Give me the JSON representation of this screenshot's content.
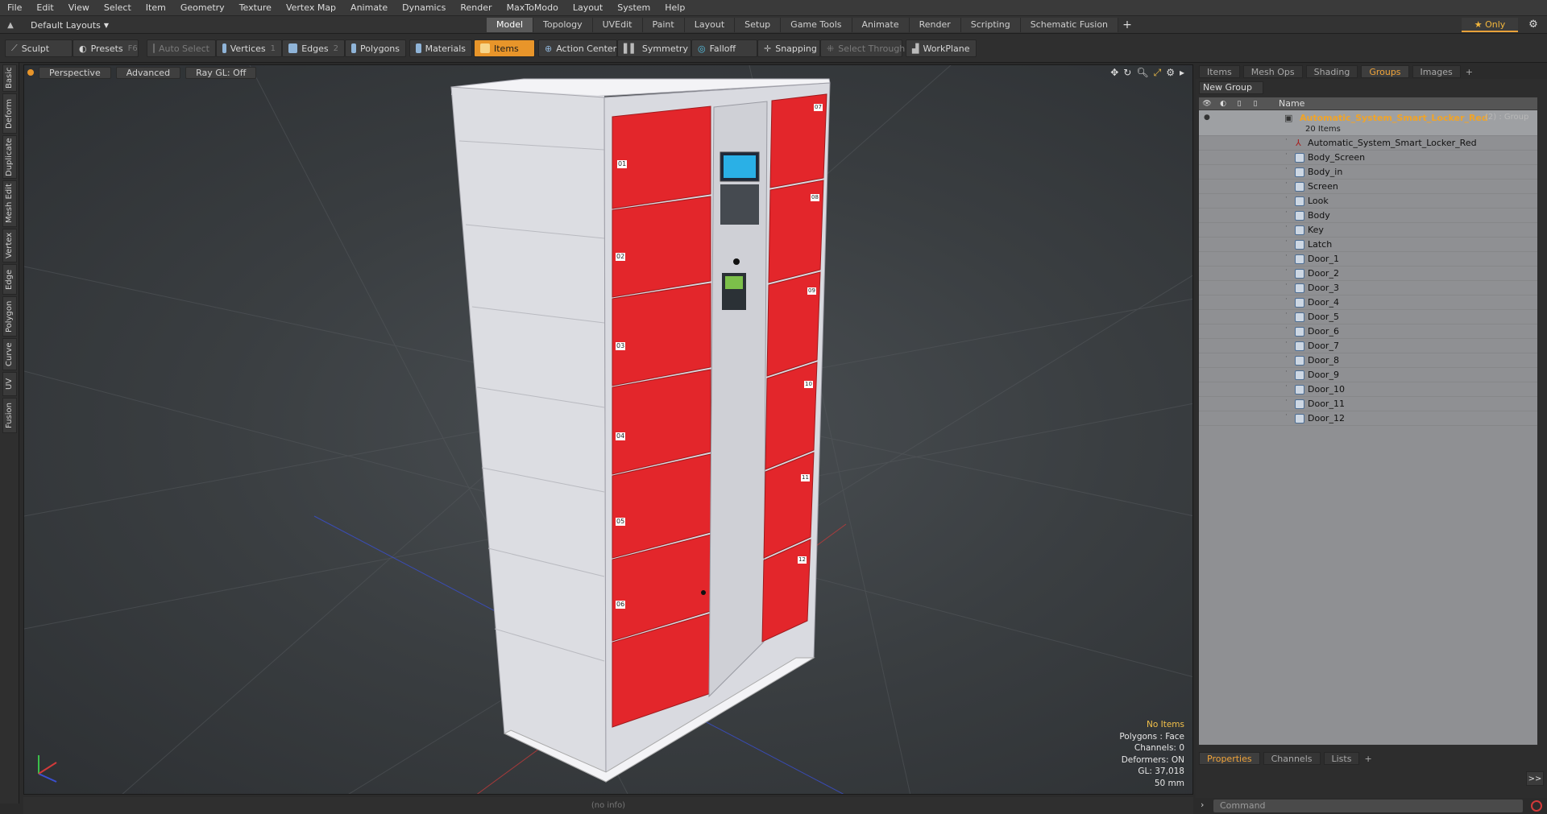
{
  "menu": [
    "File",
    "Edit",
    "View",
    "Select",
    "Item",
    "Geometry",
    "Texture",
    "Vertex Map",
    "Animate",
    "Dynamics",
    "Render",
    "MaxToModo",
    "Layout",
    "System",
    "Help"
  ],
  "layout_select": "Default Layouts",
  "mode_tabs": [
    "Model",
    "Topology",
    "UVEdit",
    "Paint",
    "Layout",
    "Setup",
    "Game Tools",
    "Animate",
    "Render",
    "Scripting",
    "Schematic Fusion"
  ],
  "active_mode": "Model",
  "only_label": "Only",
  "toolbar": {
    "sculpt": "Sculpt",
    "presets": "Presets",
    "presets_key": "F6",
    "auto_select": "Auto Select",
    "vertices": "Vertices",
    "vertices_key": "1",
    "edges": "Edges",
    "edges_key": "2",
    "polygons": "Polygons",
    "materials": "Materials",
    "items": "Items",
    "action_center": "Action Center",
    "symmetry": "Symmetry",
    "falloff": "Falloff",
    "snapping": "Snapping",
    "select_through": "Select Through",
    "workplane": "WorkPlane"
  },
  "left_tabs": [
    "Basic",
    "Deform",
    "Duplicate",
    "Mesh Edit",
    "Vertex",
    "Edge",
    "Polygon",
    "Curve",
    "UV",
    "Fusion"
  ],
  "viewport": {
    "view_label": "Perspective",
    "shading_label": "Advanced",
    "raygl_label": "Ray GL: Off",
    "info": {
      "selection": "No Items",
      "polygons": "Polygons : Face",
      "channels": "Channels: 0",
      "deformers": "Deformers: ON",
      "gl": "GL: 37,018",
      "scale": "50 mm"
    },
    "locker": {
      "door_labels": [
        "01",
        "02",
        "03",
        "04",
        "05",
        "06"
      ],
      "right_labels": [
        "07",
        "08",
        "09",
        "10",
        "11",
        "12"
      ],
      "colors": {
        "door": "#e3262b",
        "body": "#e2e3e8"
      }
    }
  },
  "status_text": "(no info)",
  "right_panel": {
    "tabs": [
      "Items",
      "Mesh Ops",
      "Shading",
      "Groups",
      "Images"
    ],
    "active_tab": "Groups",
    "new_group": "New Group",
    "name_header": "Name",
    "group": {
      "name": "Automatic_System_Smart_Locker_Red",
      "tag": "(2) : Group",
      "count": "20 Items"
    },
    "items": [
      {
        "name": "Automatic_System_Smart_Locker_Red",
        "kind": "locator"
      },
      {
        "name": "Body_Screen",
        "kind": "mesh"
      },
      {
        "name": "Body_in",
        "kind": "mesh"
      },
      {
        "name": "Screen",
        "kind": "mesh"
      },
      {
        "name": "Look",
        "kind": "mesh"
      },
      {
        "name": "Body",
        "kind": "mesh"
      },
      {
        "name": "Key",
        "kind": "mesh"
      },
      {
        "name": "Latch",
        "kind": "mesh"
      },
      {
        "name": "Door_1",
        "kind": "mesh"
      },
      {
        "name": "Door_2",
        "kind": "mesh"
      },
      {
        "name": "Door_3",
        "kind": "mesh"
      },
      {
        "name": "Door_4",
        "kind": "mesh"
      },
      {
        "name": "Door_5",
        "kind": "mesh"
      },
      {
        "name": "Door_6",
        "kind": "mesh"
      },
      {
        "name": "Door_7",
        "kind": "mesh"
      },
      {
        "name": "Door_8",
        "kind": "mesh"
      },
      {
        "name": "Door_9",
        "kind": "mesh"
      },
      {
        "name": "Door_10",
        "kind": "mesh"
      },
      {
        "name": "Door_11",
        "kind": "mesh"
      },
      {
        "name": "Door_12",
        "kind": "mesh"
      }
    ],
    "bottom_tabs": [
      "Properties",
      "Channels",
      "Lists"
    ],
    "active_bottom_tab": "Properties",
    "command_placeholder": "Command"
  }
}
